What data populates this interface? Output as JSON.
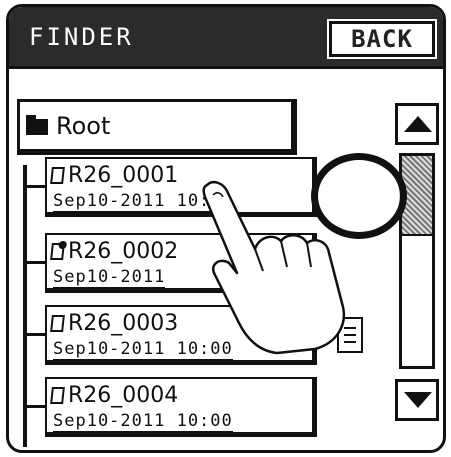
{
  "titlebar": {
    "title": "FINDER",
    "back_label": "BACK"
  },
  "root": {
    "label": "Root",
    "icon": "folder-icon"
  },
  "files": [
    {
      "name": "R26_0001",
      "date": "Sep10-2011  10:00",
      "icon": "file-icon",
      "locked": false
    },
    {
      "name": "R26_0002",
      "date": "Sep10-2011",
      "icon": "file-locked-icon",
      "locked": true
    },
    {
      "name": "R26_0003",
      "date": "Sep10-2011  10:00",
      "icon": "file-icon",
      "locked": false
    },
    {
      "name": "R26_0004",
      "date": "Sep10-2011  10:00",
      "icon": "file-icon",
      "locked": false
    }
  ],
  "scrollbar": {
    "up_icon": "triangle-up-icon",
    "down_icon": "triangle-down-icon",
    "thumb_fraction": 0.38
  },
  "colors": {
    "titlebar_bg": "#2b2b2b",
    "foreground": "#111111",
    "background": "#ffffff"
  }
}
